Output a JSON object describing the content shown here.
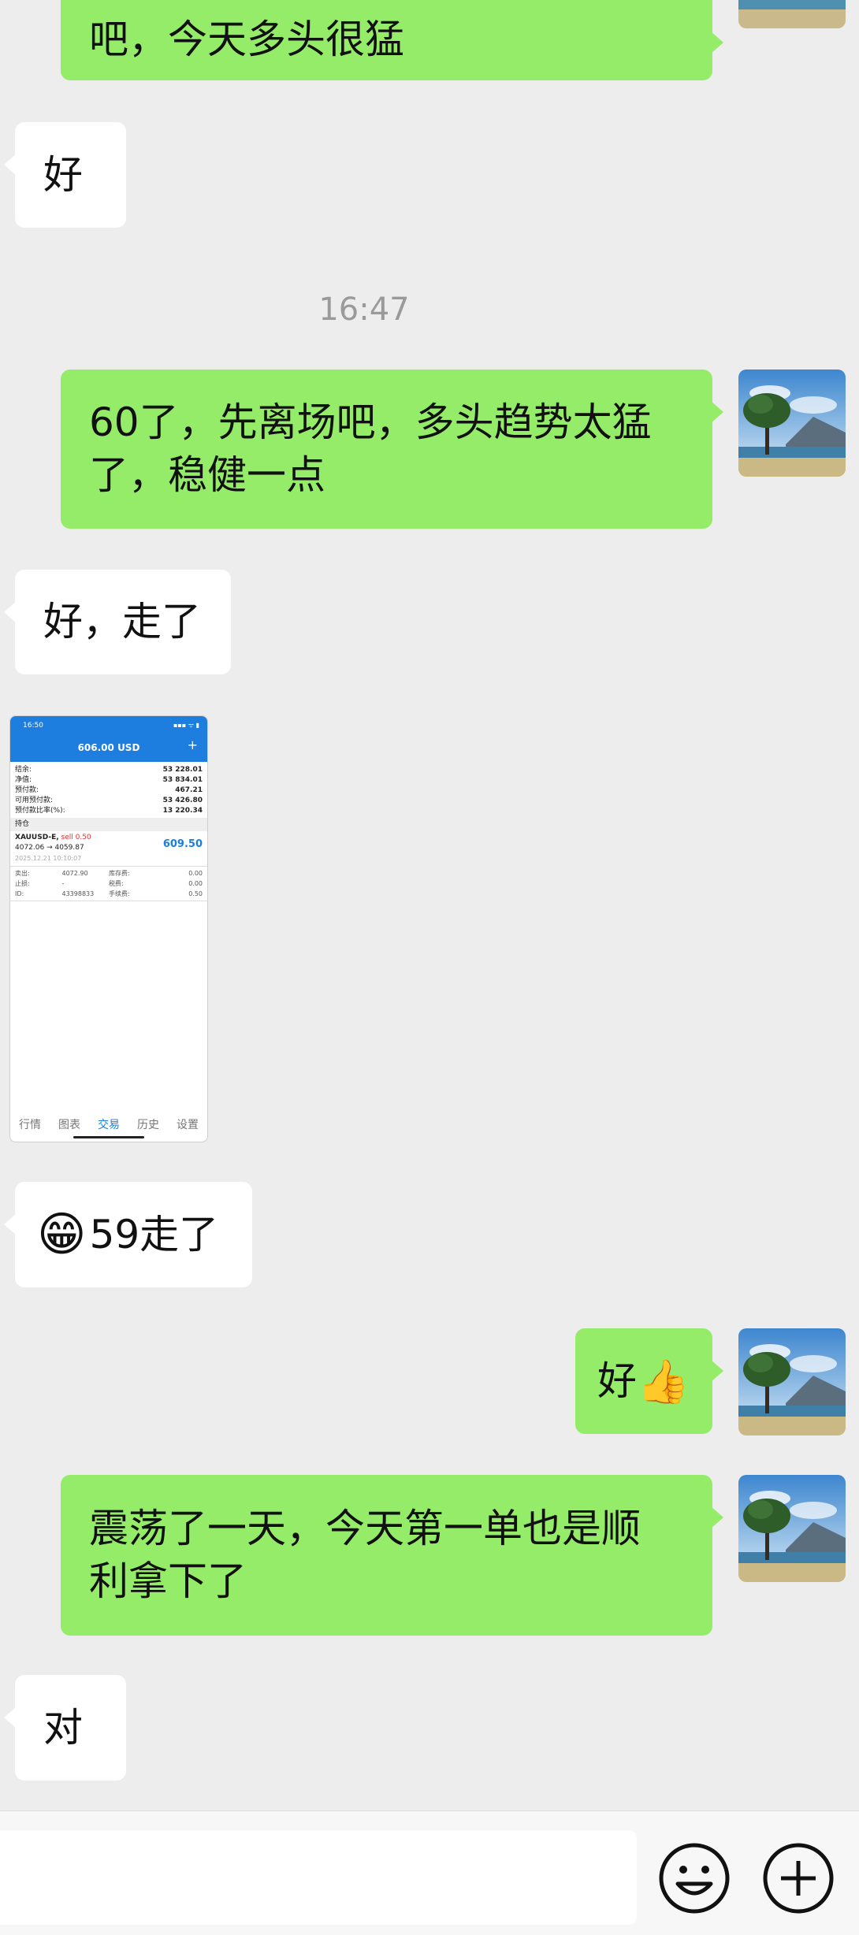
{
  "messages": [
    {
      "side": "right",
      "text": "吧，今天多头很猛"
    },
    {
      "side": "left",
      "text": "好"
    },
    {
      "type": "time",
      "text": "16:47"
    },
    {
      "side": "right",
      "line1": "60了，先离场吧，多头趋势太猛",
      "line2": "了，稳健一点"
    },
    {
      "side": "left",
      "text": "好，走了"
    },
    {
      "side": "left",
      "type": "image"
    },
    {
      "side": "left",
      "emoji": "😁",
      "text": "59走了"
    },
    {
      "side": "right",
      "text": "好",
      "emoji": "👍"
    },
    {
      "side": "right",
      "line1": "震荡了一天，今天第一单也是顺",
      "line2": "利拿下了"
    },
    {
      "side": "left",
      "text": "对"
    }
  ],
  "screenshot": {
    "status_time": "16:50",
    "status_icons": "▪▪▪ ᯤ ▮",
    "title": "606.00 USD",
    "plus": "+",
    "rows": [
      {
        "label": "结余:",
        "value": "53 228.01"
      },
      {
        "label": "净值:",
        "value": "53 834.01"
      },
      {
        "label": "预付款:",
        "value": "467.21"
      },
      {
        "label": "可用预付款:",
        "value": "53 426.80"
      },
      {
        "label": "预付款比率(%):",
        "value": "13 220.34"
      }
    ],
    "section": "持仓",
    "position": {
      "symbol": "XAUUSD-E,",
      "side": "sell 0.50",
      "prices": "4072.06 → 4059.87",
      "profit": "609.50",
      "date": "2025.12.21 10:10:07"
    },
    "details": [
      [
        "卖出:",
        "4072.90",
        "库存费:",
        "0.00"
      ],
      [
        "止损:",
        "-",
        "税费:",
        "0.00"
      ],
      [
        "ID:",
        "43398833",
        "手续费:",
        "0.50"
      ]
    ],
    "nav": [
      "行情",
      "图表",
      "交易",
      "历史",
      "设置"
    ]
  },
  "input_bar": {
    "emoji_icon": "smiley-icon",
    "plus_icon": "plus-circle-icon"
  },
  "colors": {
    "background": "#ededed",
    "bubble_self": "#95ec69",
    "bubble_other": "#ffffff",
    "timestamp": "#9a9a9a",
    "app_blue": "#1e7ee0"
  }
}
